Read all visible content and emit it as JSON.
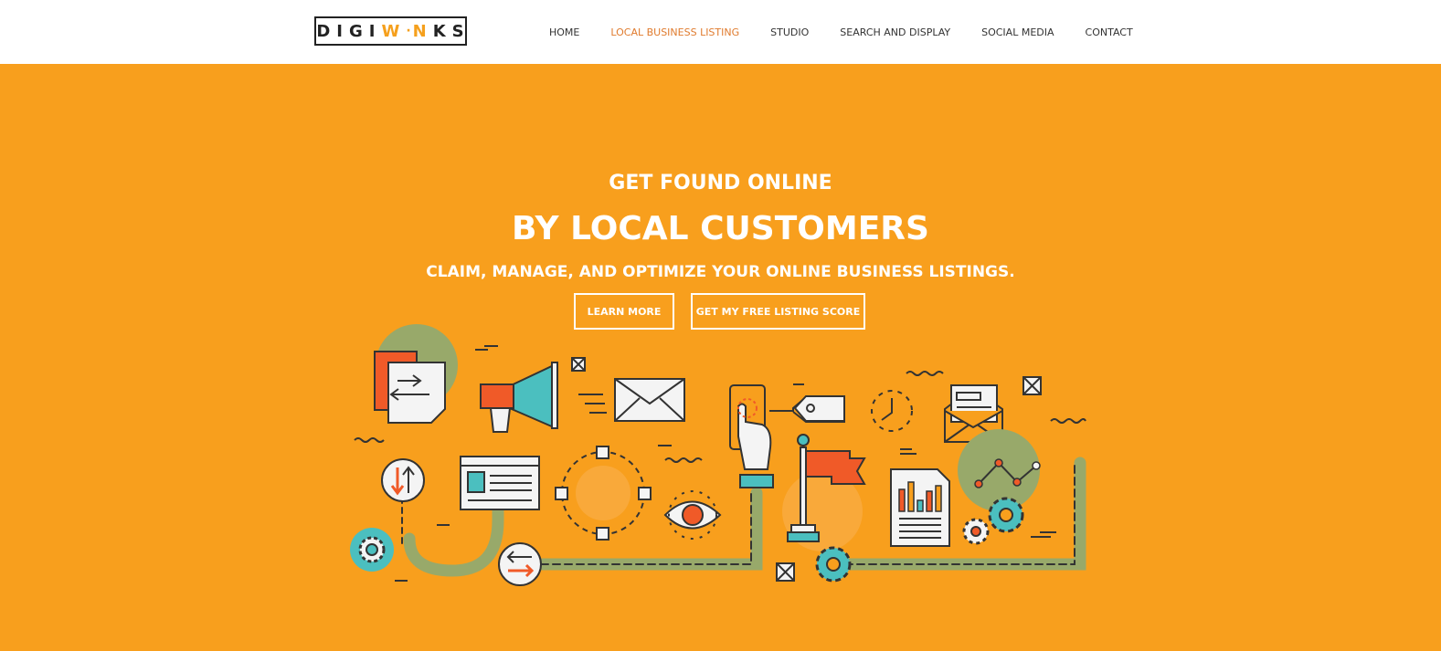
{
  "brand": {
    "logo_part1": "DIGI",
    "logo_accent": "W",
    "logo_dot": "·",
    "logo_accent2": "N",
    "logo_part2": "KS"
  },
  "nav": {
    "items": [
      {
        "label": "HOME"
      },
      {
        "label": "LOCAL BUSINESS LISTING"
      },
      {
        "label": "STUDIO"
      },
      {
        "label": "SEARCH AND DISPLAY"
      },
      {
        "label": "SOCIAL MEDIA"
      },
      {
        "label": "CONTACT"
      }
    ],
    "active_index": 1
  },
  "hero": {
    "line1": "GET FOUND ONLINE",
    "line2": "BY LOCAL CUSTOMERS",
    "line3": "CLAIM, MANAGE, AND OPTIMIZE YOUR ONLINE BUSINESS LISTINGS.",
    "btn_learn": "LEARN MORE",
    "btn_score": "GET MY FREE LISTING SCORE"
  },
  "colors": {
    "hero_bg": "#f89f1d",
    "nav_active": "#e07b2e",
    "illus_red": "#f05a28",
    "illus_teal": "#4bbfbf",
    "illus_green": "#98a96a"
  },
  "icons": [
    "document-transfer-icon",
    "megaphone-icon",
    "envelope-icon",
    "smartphone-tap-icon",
    "price-tag-icon",
    "clock-icon",
    "open-mail-icon",
    "updown-arrows-icon",
    "browser-window-icon",
    "network-circle-icon",
    "eye-icon",
    "flag-icon",
    "bar-chart-report-icon",
    "line-graph-icon",
    "gear-icon",
    "swap-arrows-icon"
  ]
}
